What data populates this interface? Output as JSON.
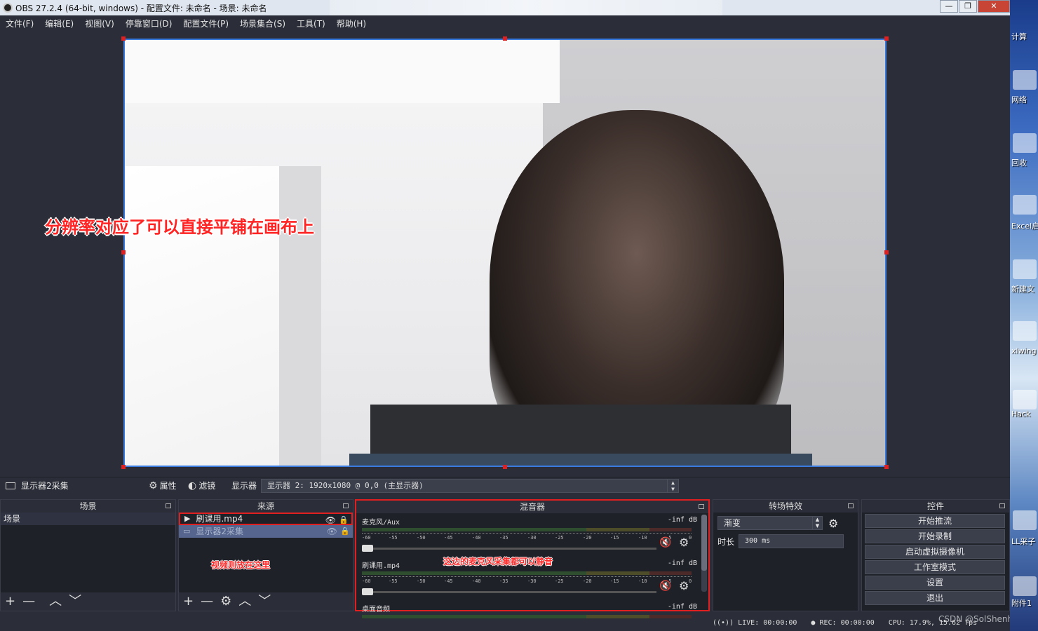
{
  "window": {
    "title": "OBS 27.2.4 (64-bit, windows) - 配置文件: 未命名 - 场景: 未命名"
  },
  "menu": [
    "文件(F)",
    "编辑(E)",
    "视图(V)",
    "停靠窗口(D)",
    "配置文件(P)",
    "场景集合(S)",
    "工具(T)",
    "帮助(H)"
  ],
  "preview": {
    "annotation": "分辨率对应了可以直接平铺在画布上"
  },
  "source_toolbar": {
    "selected_source": "显示器2采集",
    "properties": "属性",
    "filters": "滤镜",
    "display_label": "显示器",
    "display_value": "显示器 2: 1920x1080 @ 0,0 (主显示器)"
  },
  "scenes": {
    "title": "场景",
    "items": [
      "场景"
    ]
  },
  "sources": {
    "title": "来源",
    "items": [
      "刷课用.mp4",
      "显示器2采集"
    ],
    "note": "视频则放在这里"
  },
  "mixer": {
    "title": "混音器",
    "note": "这边的麦克风采集都可以静音",
    "channels": [
      {
        "name": "麦克风/Aux",
        "level": "-inf dB"
      },
      {
        "name": "刷课用.mp4",
        "level": "-inf dB"
      },
      {
        "name": "桌面音频",
        "level": "-inf dB"
      }
    ],
    "ticks": [
      "-60",
      "-55",
      "-50",
      "-45",
      "-40",
      "-35",
      "-30",
      "-25",
      "-20",
      "-15",
      "-10",
      "-5",
      "0"
    ]
  },
  "transitions": {
    "title": "转场特效",
    "selected": "渐变",
    "duration_label": "时长",
    "duration_value": "300 ms"
  },
  "controls": {
    "title": "控件",
    "buttons": [
      "开始推流",
      "开始录制",
      "启动虚拟摄像机",
      "工作室模式",
      "设置",
      "退出"
    ]
  },
  "status": {
    "live": "LIVE: 00:00:00",
    "rec": "REC: 00:00:00",
    "cpu": "CPU: 17.9%, 15.62 fps"
  },
  "watermark": "CSDN @SolShenhs",
  "desktop": {
    "labels": [
      "计算",
      "网络",
      "回收",
      "Excel启",
      "新建文",
      "xlwing",
      "Hack",
      "LL采子",
      "附件1"
    ]
  }
}
